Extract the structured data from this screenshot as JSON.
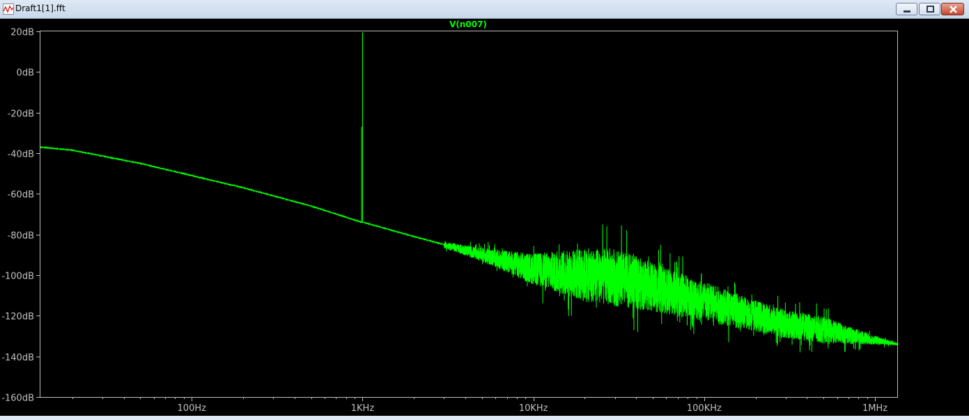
{
  "window": {
    "title": "Draft1[1].fft",
    "buttons": [
      "minimize-icon",
      "restore-icon",
      "close-icon"
    ]
  },
  "colors": {
    "background": "#000000",
    "axis": "#c0c0c0",
    "text": "#c0c0c0",
    "trace": "#00ff00"
  },
  "chart_data": {
    "type": "line",
    "title": "V(n007)",
    "xlabel": "",
    "ylabel": "",
    "x_scale": "log",
    "xlim": [
      13,
      1350000
    ],
    "ylim": [
      -160,
      20
    ],
    "x_ticks": [
      {
        "value": 100,
        "label": "100Hz"
      },
      {
        "value": 1000,
        "label": "1KHz"
      },
      {
        "value": 10000,
        "label": "10KHz"
      },
      {
        "value": 100000,
        "label": "100KHz"
      },
      {
        "value": 1000000,
        "label": "1MHz"
      }
    ],
    "y_ticks": [
      {
        "value": 20,
        "label": "20dB"
      },
      {
        "value": 0,
        "label": "0dB"
      },
      {
        "value": -20,
        "label": "-20dB"
      },
      {
        "value": -40,
        "label": "-40dB"
      },
      {
        "value": -60,
        "label": "-60dB"
      },
      {
        "value": -80,
        "label": "-80dB"
      },
      {
        "value": -100,
        "label": "-100dB"
      },
      {
        "value": -120,
        "label": "-120dB"
      },
      {
        "value": -140,
        "label": "-140dB"
      },
      {
        "value": -160,
        "label": "-160dB"
      }
    ],
    "grid": false,
    "series": [
      {
        "name": "V(n007)",
        "color": "#00ff00",
        "points": [
          {
            "x": 13,
            "y": -37
          },
          {
            "x": 20,
            "y": -38.5
          },
          {
            "x": 50,
            "y": -45
          },
          {
            "x": 100,
            "y": -51
          },
          {
            "x": 200,
            "y": -57
          },
          {
            "x": 500,
            "y": -66
          },
          {
            "x": 990,
            "y": -74
          },
          {
            "x": 1000,
            "y": 19.5
          },
          {
            "x": 1010,
            "y": -74
          },
          {
            "x": 2000,
            "y": -81
          },
          {
            "x": 5000,
            "y": -90
          },
          {
            "x": 10000,
            "y": -97
          },
          {
            "x": 20000,
            "y": -100
          },
          {
            "x": 30000,
            "y": -101
          },
          {
            "x": 50000,
            "y": -106
          },
          {
            "x": 100000,
            "y": -113
          },
          {
            "x": 200000,
            "y": -120
          },
          {
            "x": 300000,
            "y": -124
          },
          {
            "x": 500000,
            "y": -127
          },
          {
            "x": 1000000,
            "y": -132
          },
          {
            "x": 1350000,
            "y": -134
          }
        ],
        "harmonic_residue": {
          "x": 1000,
          "y": -27
        },
        "noise_band": [
          {
            "x": 3000,
            "spread": 3
          },
          {
            "x": 5000,
            "spread": 6
          },
          {
            "x": 10000,
            "spread": 14
          },
          {
            "x": 20000,
            "spread": 24
          },
          {
            "x": 30000,
            "spread": 26
          },
          {
            "x": 50000,
            "spread": 22
          },
          {
            "x": 100000,
            "spread": 18
          },
          {
            "x": 200000,
            "spread": 14
          },
          {
            "x": 500000,
            "spread": 12
          },
          {
            "x": 1000000,
            "spread": 4
          },
          {
            "x": 1350000,
            "spread": 1
          }
        ]
      }
    ]
  }
}
